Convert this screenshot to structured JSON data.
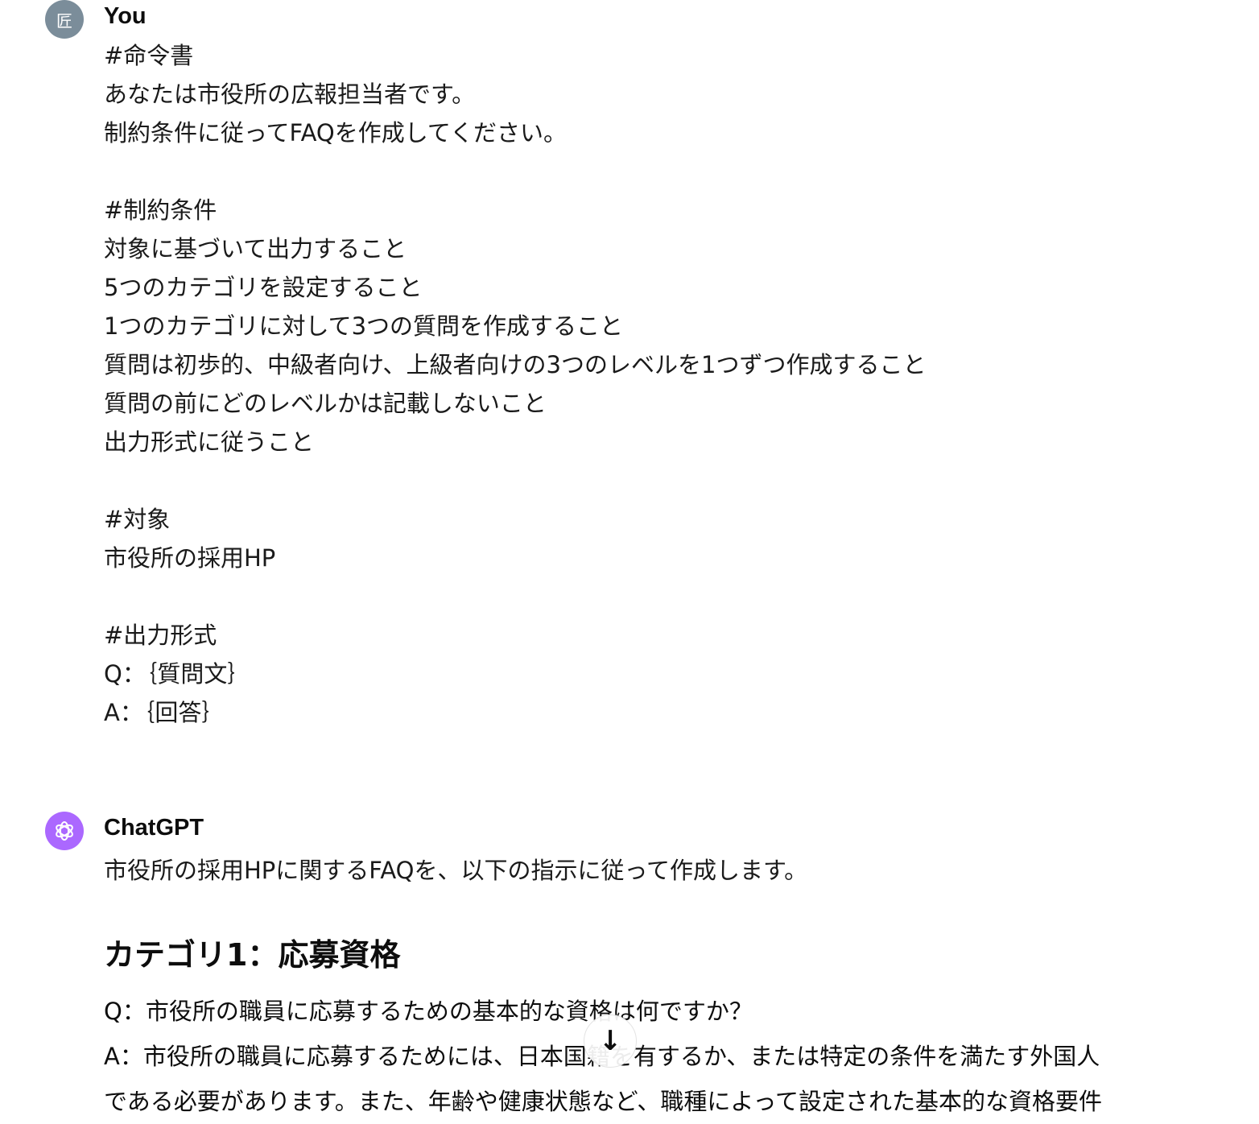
{
  "user": {
    "name": "You",
    "avatar_char": "匠",
    "message": "#命令書\nあなたは市役所の広報担当者です。\n制約条件に従ってFAQを作成してください。\n\n#制約条件\n対象に基づいて出力すること\n5つのカテゴリを設定すること\n1つのカテゴリに対して3つの質問を作成すること\n質問は初歩的、中級者向け、上級者向けの3つのレベルを1つずつ作成すること\n質問の前にどのレベルかは記載しないこと\n出力形式に従うこと\n\n#対象\n市役所の採用HP\n\n#出力形式\nQ：｛質問文｝\nA：｛回答｝"
  },
  "assistant": {
    "name": "ChatGPT",
    "intro": "市役所の採用HPに関するFAQを、以下の指示に従って作成します。",
    "heading": "カテゴリ1：応募資格",
    "q1": "Q：市役所の職員に応募するための基本的な資格は何ですか？",
    "a1_line1": "A：市役所の職員に応募するためには、日本国籍を有するか、または特定の条件を満たす外国人",
    "a1_line2": "である必要があります。また、年齢や健康状態など、職種によって設定された基本的な資格要件"
  },
  "scroll_icon": "arrow-down-icon"
}
